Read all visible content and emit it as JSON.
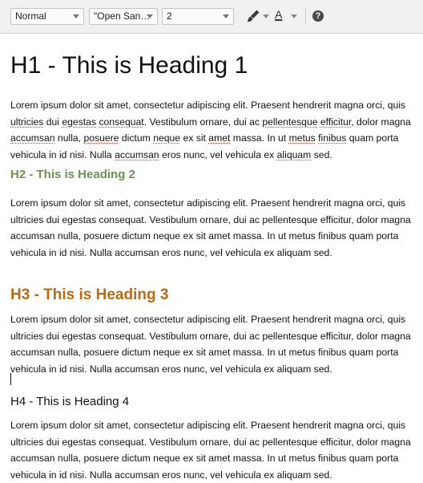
{
  "toolbar": {
    "format_select": {
      "value": "Normal"
    },
    "font_select": {
      "value": "\"Open San…"
    },
    "size_select": {
      "value": "2"
    },
    "icons": {
      "brush": "paint-brush-icon",
      "font_color": "font-color-icon",
      "help": "help-icon"
    },
    "font_color_letter": "A",
    "help_glyph": "?"
  },
  "editor": {
    "h1": "H1 - This is Heading 1",
    "h2": "H2 - This is Heading 2",
    "h3": "H3 - This is Heading 3",
    "h4": "H4 - This is Heading 4",
    "paragraph1": {
      "line1": "Lorem ipsum dolor sit amet, consectetur adipiscing elit. Praesent hendrerit magna orci, quis",
      "line2": {
        "w1": "ultricies",
        "t1": " dui ",
        "w2": "egestas",
        "t2": " ",
        "w3": "consequat",
        "t3": ". Vestibulum ornare, dui ac ",
        "w4": "pellentesque",
        "t4": " ",
        "w5": "efficitur",
        "t5": ", dolor magna"
      },
      "line3": {
        "w1": "accumsan",
        "t1": " nulla, ",
        "w2": "posuere",
        "t2": " dictum ",
        "w3": "neque",
        "t3": " ex sit ",
        "w4": "amet",
        "t4": " massa. In ut ",
        "w5": "metus",
        "t5": " ",
        "w6": "finibus",
        "t6": " quam porta"
      },
      "line4": {
        "t1": "vehicula in id nisi. Nulla ",
        "w1": "accumsan",
        "t2": " eros nunc, vel vehicula ex ",
        "w2": "aliquam",
        "t3": " sed."
      }
    },
    "paragraph_lines": [
      "Lorem ipsum dolor sit amet, consectetur adipiscing elit. Praesent hendrerit magna orci, quis",
      "ultricies dui egestas consequat. Vestibulum ornare, dui ac pellentesque efficitur, dolor magna",
      "accumsan nulla, posuere dictum neque ex sit amet massa. In ut metus finibus quam porta",
      "vehicula in id nisi. Nulla accumsan eros nunc, vel vehicula ex aliquam sed."
    ]
  },
  "colors": {
    "h2": "#6f8f53",
    "h3": "#b86a17"
  }
}
